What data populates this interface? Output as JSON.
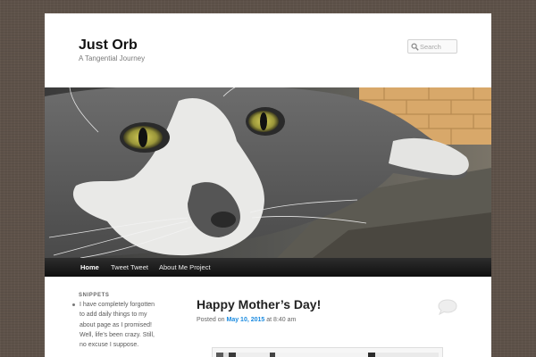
{
  "site": {
    "title": "Just Orb",
    "description": "A Tangential Journey"
  },
  "search": {
    "placeholder": "Search",
    "value": ""
  },
  "nav": {
    "items": [
      {
        "label": "Home",
        "active": true
      },
      {
        "label": "Tweet Tweet",
        "active": false
      },
      {
        "label": "About Me Project",
        "active": false
      }
    ]
  },
  "sidebar": {
    "widget_title": "SNIPPETS",
    "snippet_lines": [
      "I have completely forgotten",
      "to add daily things to my",
      "about page as I promised!",
      "Well, life's been crazy. Still,",
      "no excuse I suppose."
    ]
  },
  "post": {
    "title": "Happy Mother’s Day!",
    "posted_on": "Posted on",
    "date": "May 10, 2015",
    "at": "at",
    "time": "8:40 am"
  },
  "colors": {
    "background": "#5e5249",
    "nav_bar": "#1a1a1a",
    "link": "#1b8be0"
  },
  "icons": {
    "search": "search-icon",
    "comment": "comment-bubble-icon"
  }
}
